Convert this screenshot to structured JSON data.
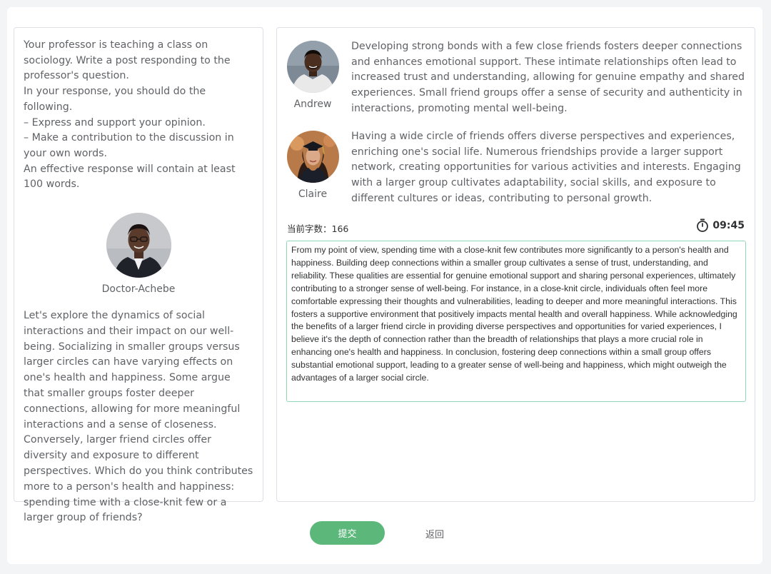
{
  "prompt": {
    "lines": [
      "Your professor is teaching a class on sociology. Write a post responding to the professor's question.",
      "In your response, you should do the following.",
      "– Express and support your opinion.",
      "– Make a contribution to the discussion in your own words.",
      "An effective response will contain at least 100 words."
    ]
  },
  "professor": {
    "name": "Doctor-Achebe",
    "question": "Let's explore the dynamics of social interactions and their impact on our well-being. Socializing in smaller groups versus larger circles can have varying effects on one's health and happiness. Some argue that smaller groups foster deeper connections, allowing for more meaningful interactions and a sense of closeness. Conversely, larger friend circles offer diversity and exposure to different perspectives. Which do you think contributes more to a person's health and happiness: spending time with a close-knit few or a larger group of friends?"
  },
  "students": [
    {
      "name": "Andrew",
      "reply": "Developing strong bonds with a few close friends fosters deeper connections and enhances emotional support. These intimate relationships often lead to increased trust and understanding, allowing for genuine empathy and shared experiences. Small friend groups offer a sense of security and authenticity in interactions, promoting mental well-being."
    },
    {
      "name": "Claire",
      "reply": "Having a wide circle of friends offers diverse perspectives and experiences, enriching one's social life. Numerous friendships provide a larger support network, creating opportunities for various activities and interests. Engaging with a larger group cultivates adaptability, social skills, and exposure to different cultures or ideas, contributing to personal growth."
    }
  ],
  "editor": {
    "word_count_label": "当前字数：166",
    "timer": "09:45",
    "essay": "From my point of view, spending time with a close-knit few contributes more significantly to a person's health and happiness. Building deep connections within a smaller group cultivates a sense of trust, understanding, and reliability. These qualities are essential for genuine emotional support and sharing personal experiences, ultimately contributing to a stronger sense of well-being. For instance, in a close-knit circle, individuals often feel more comfortable expressing their thoughts and vulnerabilities, leading to deeper and more meaningful interactions. This fosters a supportive environment that positively impacts mental health and overall happiness. While acknowledging the benefits of a larger friend circle in providing diverse perspectives and opportunities for varied experiences, I believe it's the depth of connection rather than the breadth of relationships that plays a more crucial role in enhancing one's health and happiness. In conclusion, fostering deep connections within a small group offers substantial emotional support, leading to a greater sense of well-being and happiness, which might outweigh the advantages of a larger social circle."
  },
  "actions": {
    "submit": "提交",
    "back": "返回"
  },
  "colors": {
    "accent": "#5cb87a",
    "editor_border": "#8fd8b5"
  },
  "icons": {
    "timer": "stopwatch-icon"
  }
}
